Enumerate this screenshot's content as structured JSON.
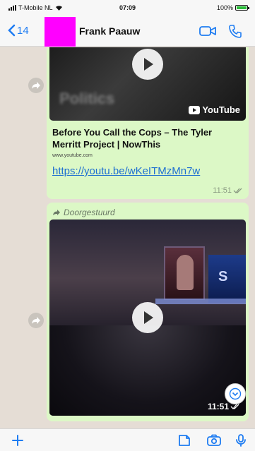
{
  "status_bar": {
    "carrier": "T-Mobile NL",
    "time": "07:09",
    "battery": "100%",
    "battery_level": 1.0
  },
  "header": {
    "back_count": "14",
    "contact_name": "Frank Paauw",
    "icons": [
      "chevron-left-icon",
      "video-call-icon",
      "phone-icon"
    ]
  },
  "messages": [
    {
      "type": "link_preview",
      "thumbnail_badge": "YouTube",
      "thumbnail_caption": "Politics",
      "title": "Before You Call the Cops – The Tyler Merritt Project | NowThis",
      "domain": "www.youtube.com",
      "url": "https://youtu.be/wKeITMzMn7w",
      "time": "11:51"
    },
    {
      "type": "video",
      "forwarded_label": "Doorgestuurd",
      "screen_text": "S",
      "time": "11:51"
    }
  ],
  "input_bar": {
    "icons": [
      "plus-icon",
      "sticker-icon",
      "camera-icon",
      "mic-icon"
    ]
  },
  "colors": {
    "accent": "#1e7cf2",
    "bubble_outgoing": "#dcf8c6",
    "chat_background": "#e5ddd5",
    "link": "#1e6fd1"
  }
}
